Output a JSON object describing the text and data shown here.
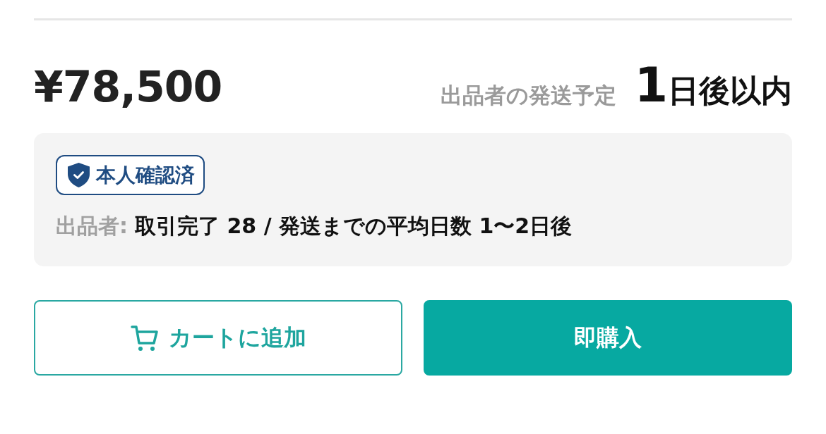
{
  "price": "¥78,500",
  "shipping": {
    "label": "出品者の発送予定",
    "days": "1",
    "suffix": "日後以内"
  },
  "seller_panel": {
    "badge": {
      "label": "本人確認済"
    },
    "seller_label": "出品者:",
    "seller_stats": "取引完了 28 / 発送までの平均日数 1〜2日後"
  },
  "buttons": [
    {
      "kind": "cart",
      "label": "カートに追加"
    },
    {
      "kind": "buy",
      "label": "即購入"
    }
  ]
}
